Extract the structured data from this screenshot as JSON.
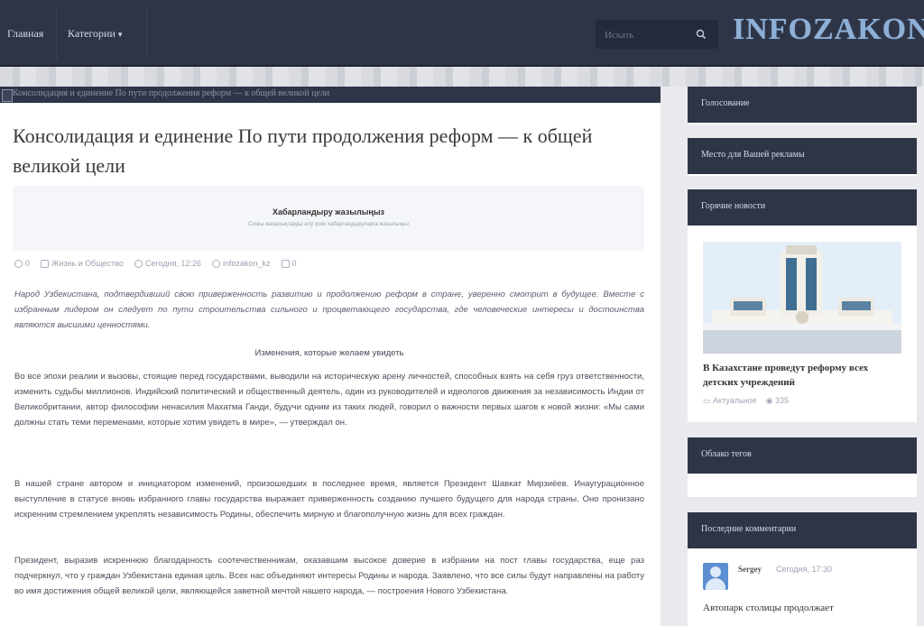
{
  "header": {
    "nav": [
      {
        "label": "Главная"
      },
      {
        "label": "Категории",
        "caret": "▾"
      }
    ],
    "search_placeholder": "Искать",
    "logo": "INFOZAKON"
  },
  "article": {
    "caption": "Консолидация и единение По пути продолжения реформ — к общей великой цели",
    "title": "Консолидация и единение По пути продолжения реформ — к общей великой цели",
    "subscribe": {
      "title": "Хабарландыру жазылыңыз",
      "subtitle": "Соңғы жаңалықтарды алу үшін хабарландыруларға жазылыңыз"
    },
    "meta": {
      "likes": "0",
      "category": "Жизнь и Общество",
      "date": "Сегодня, 12:26",
      "author": "infozakon_kz",
      "comments": "0"
    },
    "paragraphs": {
      "intro": "Народ Узбекистана, подтвердивший свою приверженность развитию и продолжению реформ в стране, уверенно смотрит в будущее. Вместе с избранным лидером он следует по пути строительства сильного и процветающего государства, где человеческие интересы и достоинства являются высшими ценностями.",
      "subheading": "Изменения, которые желаем увидеть",
      "p1": "Во все эпохи реалии и вызовы, стоящие перед государствами, выводили на историческую арену личностей, способных взять на себя груз ответственности, изменить судьбы миллионов. Индийский политический и общественный деятель, один из руководителей и идеологов движения за независимость Индии от Великобритании, автор философии ненасилия Махатма Ганди, будучи одним из таких людей, говорил о важности первых шагов к новой жизни: «Мы сами должны стать теми переменами, которые хотим увидеть в мире», — утверждал он.",
      "p2": "В нашей стране автором и инициатором изменений, произошедших в последнее время, является Президент Шавкат Мирзиёев. Инаугурационное выступление в статусе вновь избранного главы государства выражает приверженность созданию лучшего будущего для народа страны. Оно пронизано искренним стремлением укреплять независимость Родины, обеспечить мирную и благополучную жизнь для всех граждан.",
      "p3": "Президент, выразив искреннюю благодарность соотечественникам, оказавшим высокое доверие в избрании на пост главы государства, еще раз подчеркнул, что у граждан Узбекистана единая цель. Всех нас объединяют интересы Родины и народа. Заявлено, что все силы будут направлены на работу во имя достижения общей великой цели, являющейся заветной мечтой нашего народа, — построения Нового Узбекистана."
    }
  },
  "sidebar": {
    "widgets": [
      {
        "title": "Голосование"
      },
      {
        "title": "Место для Вашей рекламы"
      },
      {
        "title": "Горячие новости"
      },
      {
        "title": "Облако тегов"
      },
      {
        "title": "Последние комментарии"
      }
    ],
    "hot_news": {
      "title": "В Казахстане проведут реформу всех детских учреждений",
      "category": "Актуальное",
      "views": "335"
    },
    "comment": {
      "author": "Sergey",
      "time": "Сегодня, 17:30",
      "text": "Автопарк столицы продолжает"
    }
  },
  "colors": {
    "navy": "#2e3547",
    "logo": "#8fb0d6",
    "background": "#e9eaee"
  }
}
